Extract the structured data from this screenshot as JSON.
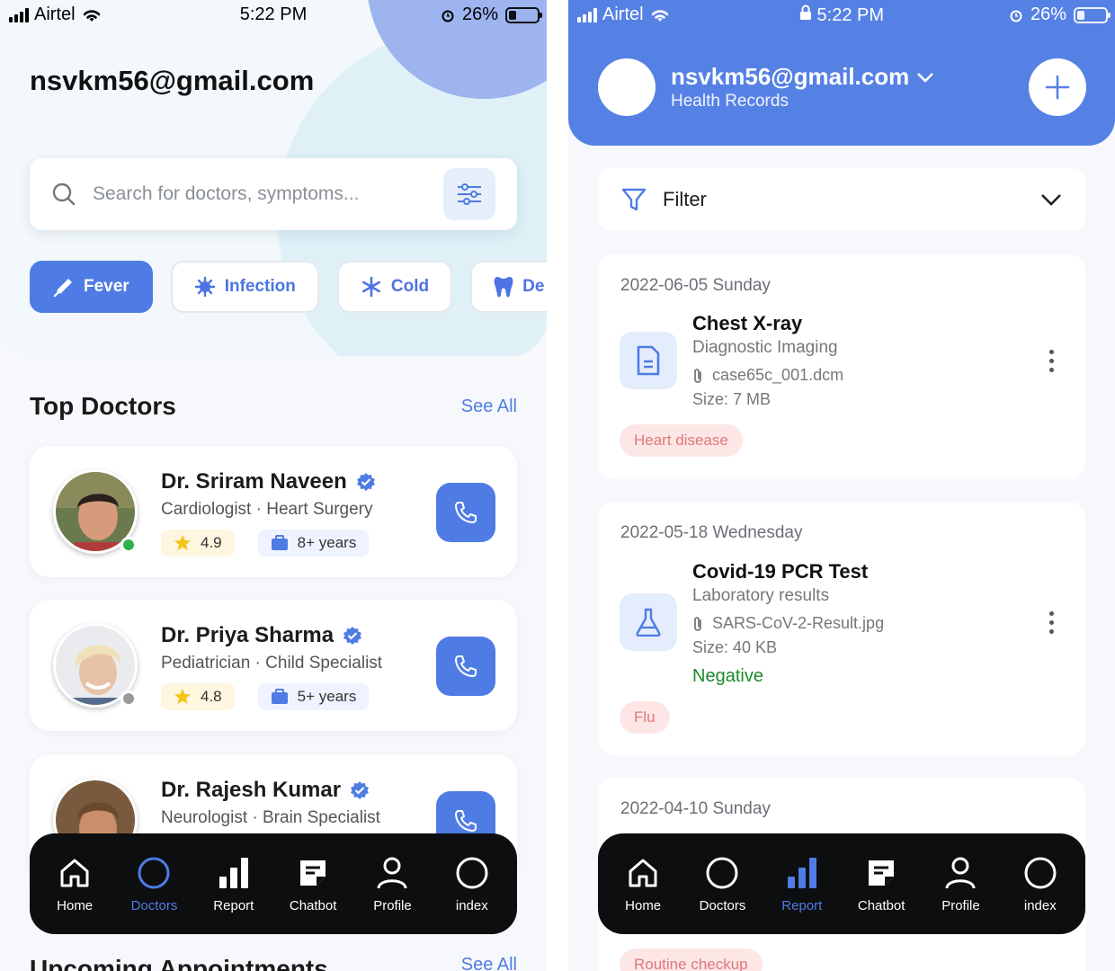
{
  "left": {
    "status": {
      "carrier": "Airtel",
      "time": "5:22 PM",
      "battery": "26%",
      "battery_level": 0.26
    },
    "user_email": "nsvkm56@gmail.com",
    "search": {
      "placeholder": "Search for doctors, symptoms..."
    },
    "chips": [
      {
        "label": "Fever",
        "icon": "thermometer-icon",
        "active": true
      },
      {
        "label": "Infection",
        "icon": "virus-icon",
        "active": false
      },
      {
        "label": "Cold",
        "icon": "snowflake-icon",
        "active": false
      },
      {
        "label": "De",
        "icon": "tooth-icon",
        "active": false
      }
    ],
    "top_doctors": {
      "title": "Top Doctors",
      "see_all": "See All"
    },
    "doctors": [
      {
        "name": "Dr. Sriram Naveen",
        "specialty": "Cardiologist",
        "subspecialty": "Heart Surgery",
        "rating": "4.9",
        "experience": "8+ years",
        "online": true
      },
      {
        "name": "Dr. Priya Sharma",
        "specialty": "Pediatrician",
        "subspecialty": "Child Specialist",
        "rating": "4.8",
        "experience": "5+ years",
        "online": false
      },
      {
        "name": "Dr. Rajesh Kumar",
        "specialty": "Neurologist",
        "subspecialty": "Brain Specialist",
        "rating": "",
        "experience": "",
        "online": false
      }
    ],
    "nav": [
      {
        "label": "Home",
        "icon": "home-icon",
        "active": false
      },
      {
        "label": "Doctors",
        "icon": "circle-icon",
        "active": true
      },
      {
        "label": "Report",
        "icon": "bar-chart-icon",
        "active": false
      },
      {
        "label": "Chatbot",
        "icon": "note-icon",
        "active": false
      },
      {
        "label": "Profile",
        "icon": "user-icon",
        "active": false
      },
      {
        "label": "index",
        "icon": "circle-icon",
        "active": false
      }
    ],
    "upcoming": {
      "title": "Upcoming Appointments",
      "see_all": "See All"
    }
  },
  "right": {
    "status": {
      "carrier": "Airtel",
      "time": "5:22 PM",
      "battery": "26%",
      "battery_level": 0.26
    },
    "account": {
      "email": "nsvkm56@gmail.com",
      "subtitle": "Health Records"
    },
    "filter": {
      "label": "Filter"
    },
    "records": [
      {
        "date": "2022-06-05 Sunday",
        "title": "Chest X-ray",
        "category": "Diagnostic Imaging",
        "file": "case65c_001.dcm",
        "size": "Size: 7 MB",
        "result": "",
        "tag": "Heart disease",
        "icon": "document-icon"
      },
      {
        "date": "2022-05-18 Wednesday",
        "title": "Covid-19 PCR Test",
        "category": "Laboratory results",
        "file": "SARS-CoV-2-Result.jpg",
        "size": "Size: 40 KB",
        "result": "Negative",
        "tag": "Flu",
        "icon": "flask-icon"
      },
      {
        "date": "2022-04-10 Sunday",
        "tag": "Routine checkup"
      }
    ],
    "nav": [
      {
        "label": "Home",
        "icon": "home-icon",
        "active": false
      },
      {
        "label": "Doctors",
        "icon": "circle-icon",
        "active": false
      },
      {
        "label": "Report",
        "icon": "bar-chart-icon",
        "active": true
      },
      {
        "label": "Chatbot",
        "icon": "note-icon",
        "active": false
      },
      {
        "label": "Profile",
        "icon": "user-icon",
        "active": false
      },
      {
        "label": "index",
        "icon": "circle-icon",
        "active": false
      }
    ]
  },
  "colors": {
    "primary": "#4f7ce4",
    "header": "#5681e4",
    "nav_bg": "#0d0e10",
    "success": "#1b8a2a",
    "tag_bg": "#fde6e6",
    "tag_text": "#e07878"
  }
}
